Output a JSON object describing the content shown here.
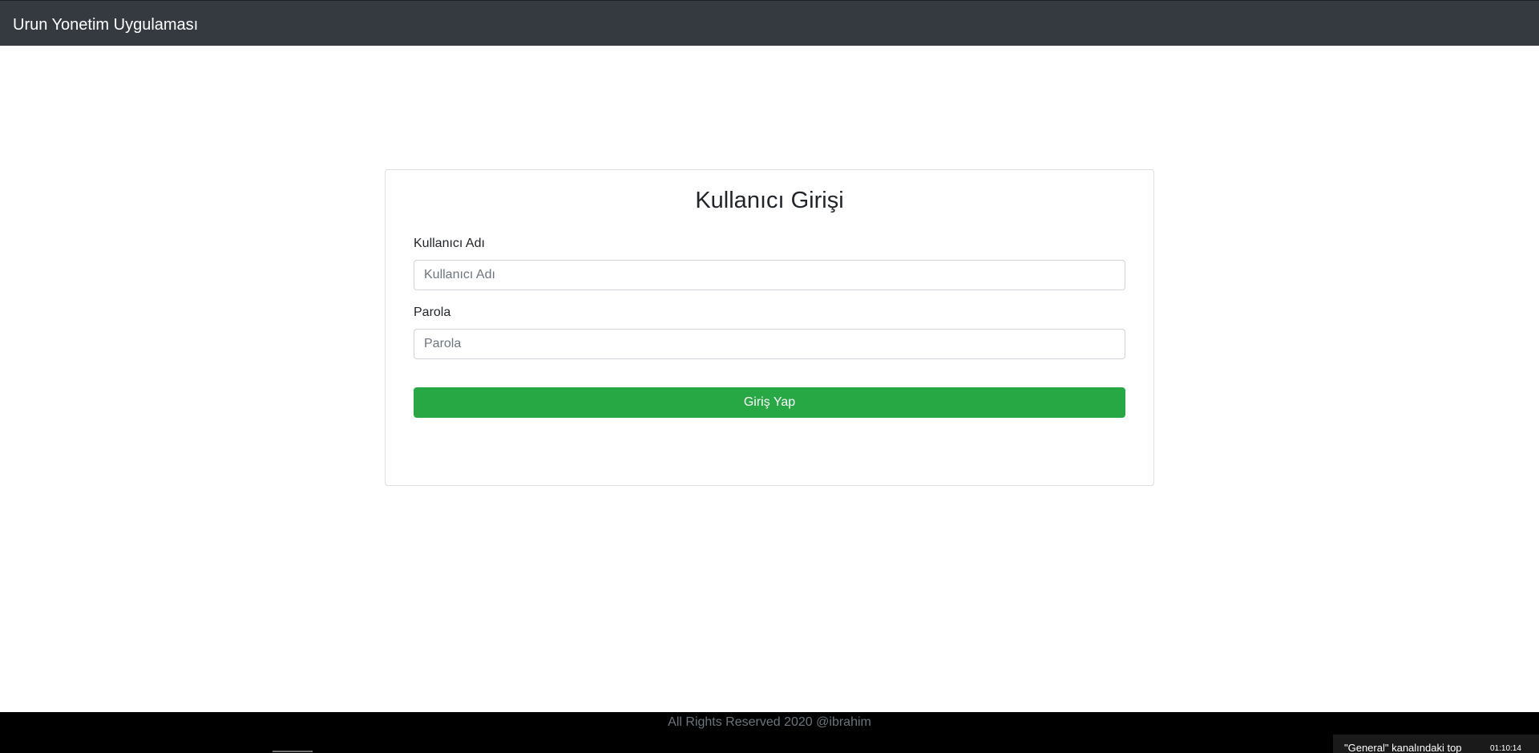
{
  "navbar": {
    "brand": "Urun Yonetim Uygulaması",
    "background_color": "#343a40"
  },
  "login_card": {
    "title": "Kullanıcı Girişi",
    "username": {
      "label": "Kullanıcı Adı",
      "placeholder": "Kullanıcı Adı",
      "value": ""
    },
    "password": {
      "label": "Parola",
      "placeholder": "Parola",
      "value": ""
    },
    "submit_label": "Giriş Yap",
    "submit_color": "#28a745"
  },
  "footer": {
    "text": "All Rights Reserved 2020 @ibrahim",
    "background_color": "#000000"
  },
  "notification": {
    "text": "\"General\" kanalındaki top",
    "time": "01:10:14"
  }
}
